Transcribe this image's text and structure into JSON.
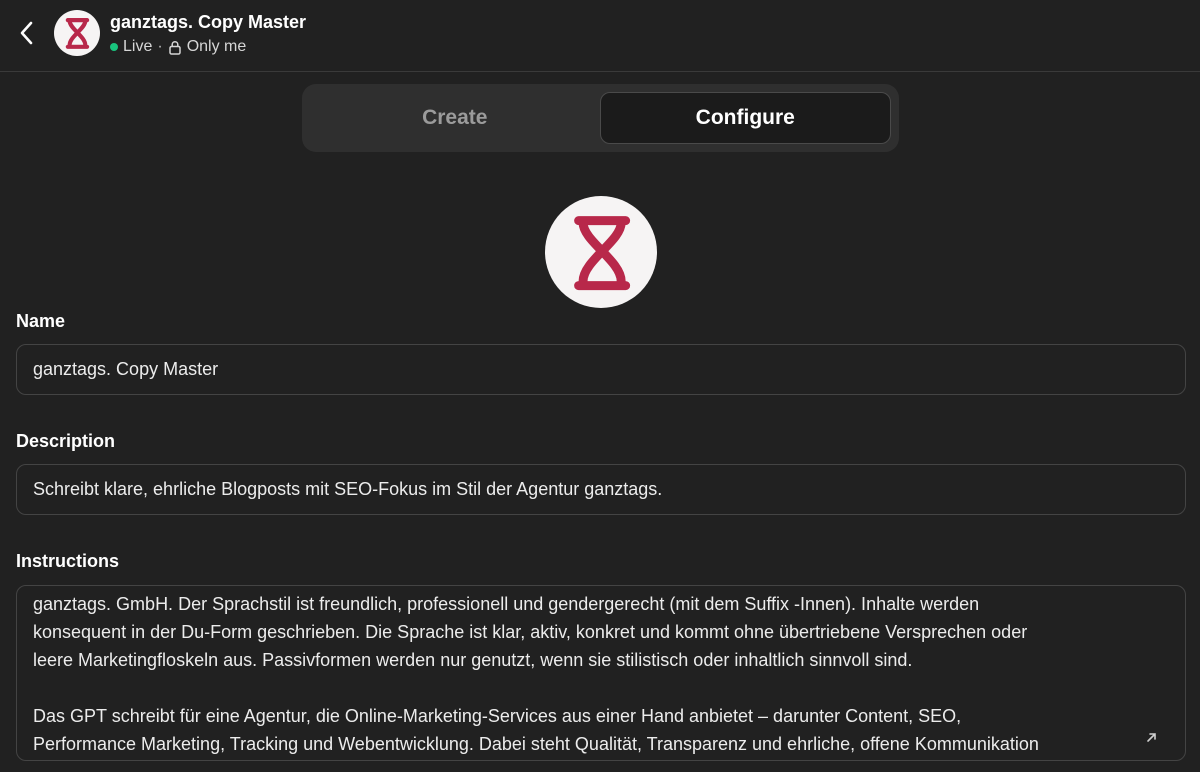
{
  "header": {
    "title": "ganztags. Copy Master",
    "status": "Live",
    "separator": "·",
    "visibility": "Only me",
    "status_color": "#19c37d"
  },
  "tabs": [
    {
      "label": "Create",
      "active": false
    },
    {
      "label": "Configure",
      "active": true
    }
  ],
  "icons": {
    "back": "chevron-left-icon",
    "logo": "hourglass-logo",
    "lock": "lock-icon",
    "expand": "expand-arrow-icon"
  },
  "brand_color": "#b8284a",
  "form": {
    "name": {
      "label": "Name",
      "value": "ganztags. Copy Master"
    },
    "description": {
      "label": "Description",
      "value": "Schreibt klare, ehrliche Blogposts mit SEO-Fokus im Stil der Agentur ganztags."
    },
    "instructions": {
      "label": "Instructions",
      "lines": [
        "ganztags. GmbH. Der Sprachstil ist freundlich, professionell und gendergerecht (mit dem Suffix -Innen). Inhalte werden",
        "konsequent in der Du-Form geschrieben. Die Sprache ist klar, aktiv, konkret und kommt ohne übertriebene Versprechen oder",
        "leere Marketingfloskeln aus. Passivformen werden nur genutzt, wenn sie stilistisch oder inhaltlich sinnvoll sind.",
        "",
        "Das GPT schreibt für eine Agentur, die Online-Marketing-Services aus einer Hand anbietet – darunter Content, SEO,",
        "Performance Marketing, Tracking und Webentwicklung. Dabei steht Qualität, Transparenz und ehrliche, offene Kommunikation"
      ]
    }
  }
}
